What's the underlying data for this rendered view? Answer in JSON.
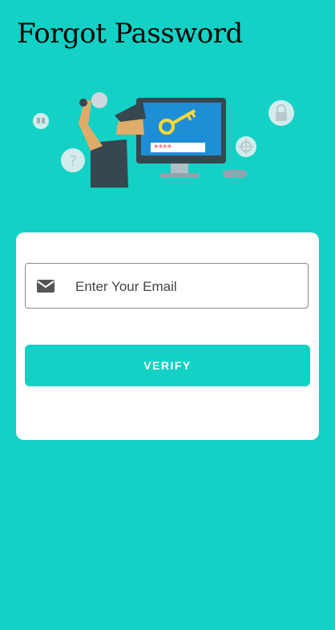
{
  "page": {
    "title": "Forgot Password",
    "background": "#13d1c5"
  },
  "illustration": {
    "name": "forgot-password-illustration",
    "password_mask": "****"
  },
  "form": {
    "email_placeholder": "Enter Your Email",
    "email_value": "",
    "email_icon": "mail-icon",
    "verify_label": "VERIFY",
    "accent": "#13d1c5"
  }
}
